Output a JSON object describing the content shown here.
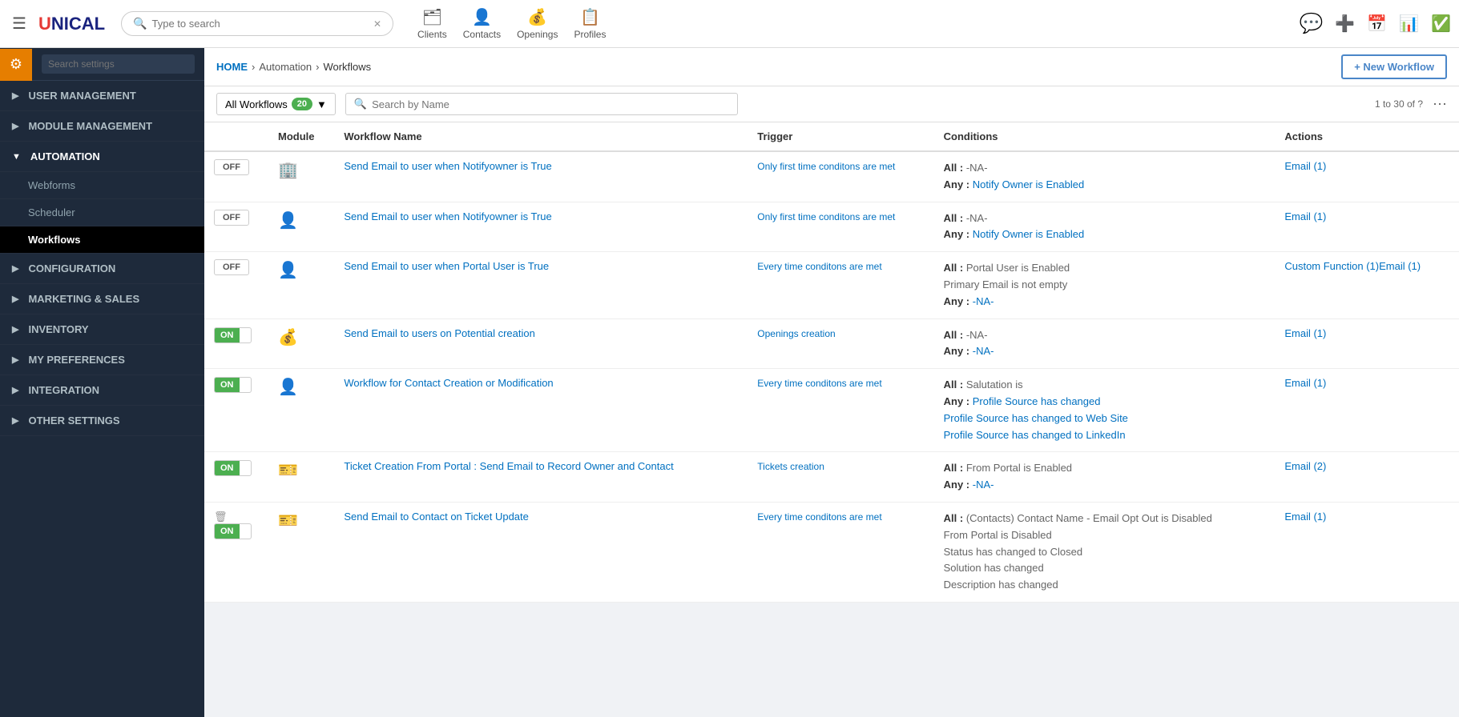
{
  "app": {
    "logo": "UNICAL",
    "logo_u": "U",
    "logo_nical": "NICAL"
  },
  "topnav": {
    "search_placeholder": "Type to search",
    "items": [
      {
        "label": "Clients",
        "icon": "🗂"
      },
      {
        "label": "Contacts",
        "icon": "👤"
      },
      {
        "label": "Openings",
        "icon": "💰"
      },
      {
        "label": "Profiles",
        "icon": "📋"
      }
    ]
  },
  "breadcrumb": {
    "home": "HOME",
    "path": [
      "Automation",
      "Workflows"
    ]
  },
  "sidebar": {
    "search_placeholder": "Search settings",
    "items": [
      {
        "label": "USER MANAGEMENT",
        "expanded": false
      },
      {
        "label": "MODULE MANAGEMENT",
        "expanded": false
      },
      {
        "label": "AUTOMATION",
        "expanded": true,
        "children": [
          "Webforms",
          "Scheduler",
          "Workflows"
        ]
      },
      {
        "label": "CONFIGURATION",
        "expanded": false
      },
      {
        "label": "MARKETING & SALES",
        "expanded": false
      },
      {
        "label": "INVENTORY",
        "expanded": false
      },
      {
        "label": "MY PREFERENCES",
        "expanded": false
      },
      {
        "label": "INTEGRATION",
        "expanded": false
      },
      {
        "label": "OTHER SETTINGS",
        "expanded": false
      }
    ]
  },
  "page": {
    "new_workflow_label": "+ New Workflow",
    "filter_label": "All Workflows",
    "filter_count": "20",
    "search_placeholder": "Search by Name",
    "pagination": "1 to 30 of ?",
    "columns": [
      "Module",
      "Workflow Name",
      "Trigger",
      "Conditions",
      "Actions"
    ]
  },
  "workflows": [
    {
      "toggle": "OFF",
      "module_icon": "🏢",
      "name": "Send Email to user when Notifyowner is True",
      "trigger": "Only first time conditons are met",
      "conditions": {
        "all": "-NA-",
        "any": "Notify Owner is Enabled"
      },
      "actions": "Email (1)"
    },
    {
      "toggle": "OFF",
      "module_icon": "👤",
      "name": "Send Email to user when Notifyowner is True",
      "trigger": "Only first time conditons are met",
      "conditions": {
        "all": "-NA-",
        "any": "Notify Owner is Enabled"
      },
      "actions": "Email (1)"
    },
    {
      "toggle": "OFF",
      "module_icon": "👤",
      "name": "Send Email to user when Portal User is True",
      "trigger": "Every time conditons are met",
      "conditions": {
        "all": "Portal User is Enabled\nPrimary Email is not empty",
        "any": "-NA-"
      },
      "actions": "Custom Function (1)Email (1)"
    },
    {
      "toggle": "ON",
      "module_icon": "💰",
      "name": "Send Email to users on Potential creation",
      "trigger": "Openings creation",
      "conditions": {
        "all": "-NA-",
        "any": "-NA-"
      },
      "actions": "Email (1)"
    },
    {
      "toggle": "ON",
      "module_icon": "👤",
      "name": "Workflow for Contact Creation or Modification",
      "trigger": "Every time conditons are met",
      "conditions": {
        "all": "Salutation is",
        "any": "Profile Source has changed\nProfile Source has changed to Web Site\nProfile Source has changed to LinkedIn"
      },
      "actions": "Email (1)"
    },
    {
      "toggle": "ON",
      "module_icon": "🎫",
      "name": "Ticket Creation From Portal : Send Email to Record Owner and Contact",
      "trigger": "Tickets creation",
      "conditions": {
        "all": "From Portal is Enabled",
        "any": "-NA-"
      },
      "actions": "Email (2)"
    },
    {
      "toggle": "ON",
      "module_icon": "🎫",
      "name": "Send Email to Contact on Ticket Update",
      "trigger": "Every time conditons are met",
      "conditions": {
        "all": "(Contacts) Contact Name - Email Opt Out is Disabled\nFrom Portal is Disabled\nStatus has changed to Closed\nSolution has changed\nDescription has changed",
        "any": ""
      },
      "actions": "Email (1)",
      "has_delete": true
    }
  ]
}
